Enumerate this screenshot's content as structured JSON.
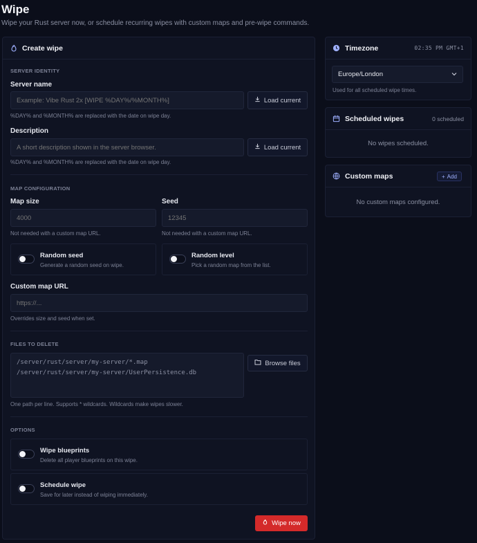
{
  "page": {
    "title": "Wipe",
    "subtitle": "Wipe your Rust server now, or schedule recurring wipes with custom maps and pre-wipe commands."
  },
  "create_wipe": {
    "title": "Create wipe",
    "server_identity": {
      "section": "SERVER IDENTITY",
      "server_name": {
        "label": "Server name",
        "placeholder": "Example: Vibe Rust 2x [WIPE %DAY%/%MONTH%]",
        "value": "",
        "button": "Load current",
        "hint": "%DAY% and %MONTH% are replaced with the date on wipe day."
      },
      "description": {
        "label": "Description",
        "placeholder": "A short description shown in the server browser.",
        "value": "",
        "button": "Load current",
        "hint": "%DAY% and %MONTH% are replaced with the date on wipe day."
      }
    },
    "map_configuration": {
      "section": "MAP CONFIGURATION",
      "map_size": {
        "label": "Map size",
        "placeholder": "4000",
        "hint": "Not needed with a custom map URL."
      },
      "seed": {
        "label": "Seed",
        "placeholder": "12345",
        "hint": "Not needed with a custom map URL."
      },
      "random_seed": {
        "title": "Random seed",
        "desc": "Generate a random seed on wipe.",
        "enabled": false
      },
      "random_level": {
        "title": "Random level",
        "desc": "Pick a random map from the list.",
        "enabled": false
      },
      "custom_map_url": {
        "label": "Custom map URL",
        "placeholder": "https://...",
        "hint": "Overrides size and seed when set."
      }
    },
    "files_to_delete": {
      "section": "FILES TO DELETE",
      "value": "/server/rust/server/my-server/*.map\n/server/rust/server/my-server/UserPersistence.db",
      "button": "Browse files",
      "hint": "One path per line. Supports * wildcards. Wildcards make wipes slower."
    },
    "options": {
      "section": "OPTIONS",
      "wipe_blueprints": {
        "title": "Wipe blueprints",
        "desc": "Delete all player blueprints on this wipe.",
        "enabled": false
      },
      "schedule_wipe": {
        "title": "Schedule wipe",
        "desc": "Save for later instead of wiping immediately.",
        "enabled": false
      }
    },
    "wipe_now": "Wipe now"
  },
  "timezone": {
    "title": "Timezone",
    "time": "02:35 PM GMT+1",
    "selected": "Europe/London",
    "hint": "Used for all scheduled wipe times."
  },
  "scheduled_wipes": {
    "title": "Scheduled wipes",
    "count": "0 scheduled",
    "empty": "No wipes scheduled."
  },
  "custom_maps": {
    "title": "Custom maps",
    "add": "Add",
    "empty": "No custom maps configured."
  },
  "colors": {
    "background": "#0b0e1a",
    "card": "#0f1322",
    "accent_red": "#d42a2a",
    "accent_blue": "#9fb0ff"
  }
}
